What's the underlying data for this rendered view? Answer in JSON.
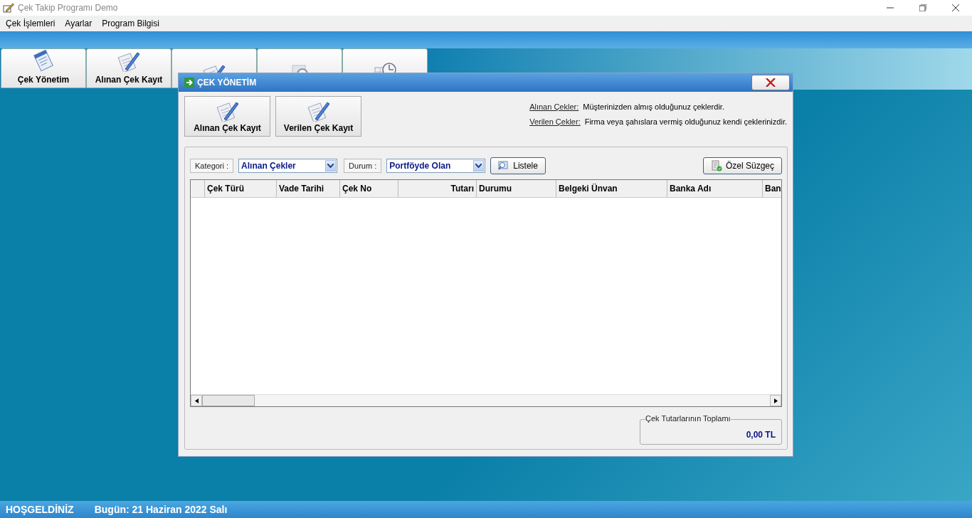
{
  "window": {
    "title": "Çek Takip Programı Demo"
  },
  "menu": [
    "Çek İşlemleri",
    "Ayarlar",
    "Program Bilgisi"
  ],
  "toolbar": [
    {
      "kind": "document",
      "label": "Çek Yönetim"
    },
    {
      "kind": "pen",
      "label": "Alınan Çek Kayıt"
    },
    {
      "kind": "pen"
    },
    {
      "kind": "search"
    },
    {
      "kind": "calendar"
    }
  ],
  "dialog": {
    "title": "ÇEK YÖNETİM",
    "buttons": [
      {
        "label": "Alınan Çek Kayıt"
      },
      {
        "label": "Verilen Çek Kayıt"
      }
    ],
    "legend": [
      {
        "term": "Alınan Çekler:",
        "text": "Müşterinizden almış olduğunuz çeklerdir."
      },
      {
        "term": "Verilen Çekler:",
        "text": "Firma veya şahıslara vermiş olduğunuz kendi çeklerinizdir."
      }
    ],
    "filters": [
      {
        "label": "Kategori :",
        "value": "Alınan Çekler"
      },
      {
        "label": "Durum :",
        "value": "Portföyde Olan"
      }
    ],
    "list_button": "Listele",
    "filter_button": "Özel Süzgeç",
    "table": {
      "columns": [
        "Çek Türü",
        "Vade Tarihi",
        "Çek No",
        "Tutarı",
        "Durumu",
        "Belgeki Ünvan",
        "Banka Adı",
        "Ban"
      ]
    },
    "total": {
      "label": "Çek Tutarlarının Toplamı",
      "value": "0,00 TL"
    }
  },
  "status_bar": {
    "welcome": "HOŞGELDİNİZ",
    "today": "Bugün: 21 Haziran 2022 Salı"
  }
}
